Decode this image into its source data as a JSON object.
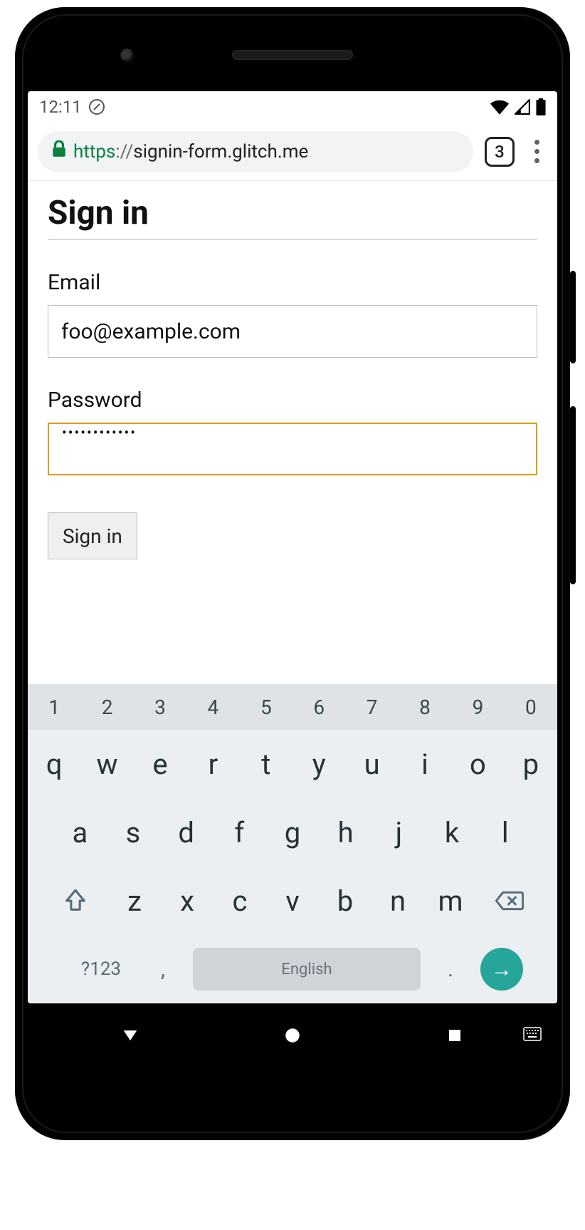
{
  "status": {
    "time": "12:11",
    "tab_count": "3"
  },
  "url": {
    "scheme": "https",
    "sep": "://",
    "host_path": "signin-form.glitch.me"
  },
  "page": {
    "title": "Sign in",
    "email_label": "Email",
    "email_value": "foo@example.com",
    "password_label": "Password",
    "password_masked": "••••••••••••",
    "submit_label": "Sign in"
  },
  "keyboard": {
    "numbers": [
      "1",
      "2",
      "3",
      "4",
      "5",
      "6",
      "7",
      "8",
      "9",
      "0"
    ],
    "row1": [
      "q",
      "w",
      "e",
      "r",
      "t",
      "y",
      "u",
      "i",
      "o",
      "p"
    ],
    "row2": [
      "a",
      "s",
      "d",
      "f",
      "g",
      "h",
      "j",
      "k",
      "l"
    ],
    "row3": [
      "z",
      "x",
      "c",
      "v",
      "b",
      "n",
      "m"
    ],
    "symbols_label": "?123",
    "comma": ",",
    "space_label": "English",
    "period": ".",
    "enter_glyph": "→"
  }
}
